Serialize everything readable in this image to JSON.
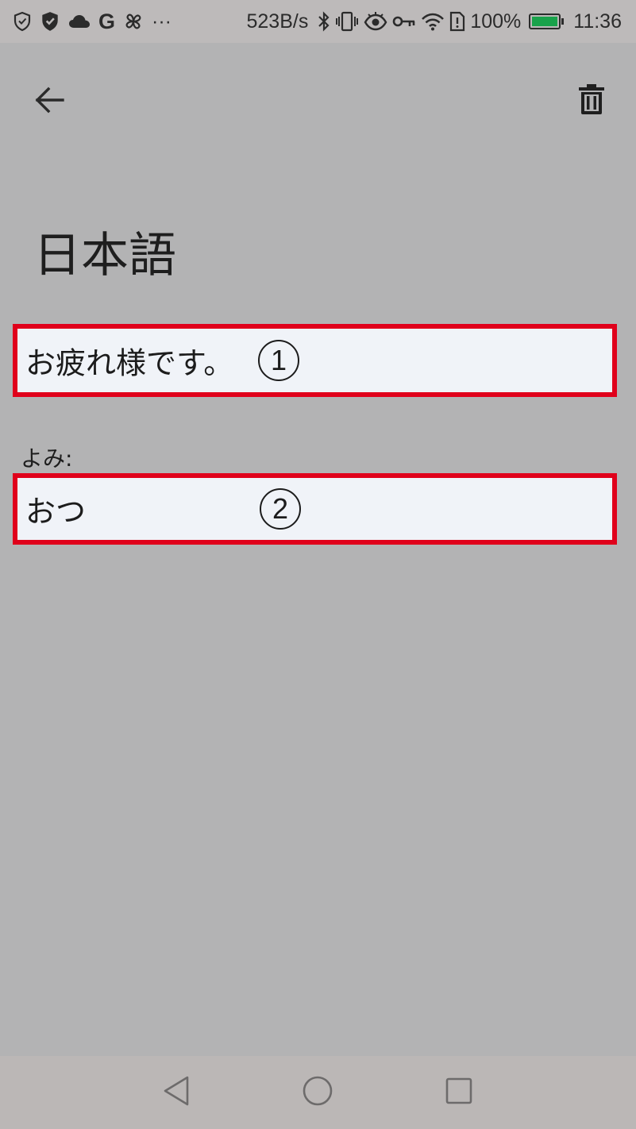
{
  "status_bar": {
    "left_icons": [
      "shield-outline-icon",
      "shield-check-icon",
      "cloud-icon",
      "google-g-icon",
      "pinwheel-icon",
      "more-dots-icon"
    ],
    "google_letter": "G",
    "more": "···",
    "net_speed": "523B/s",
    "right_icons": [
      "bluetooth-icon",
      "vibrate-icon",
      "eye-icon",
      "key-icon",
      "wifi-icon",
      "sim-alert-icon",
      "battery-icon"
    ],
    "battery": "100%",
    "battery_level": 1.0,
    "time": "11:36",
    "battery_color": "#19a24b"
  },
  "toolbar": {
    "back_icon": "arrow-left-icon",
    "delete_icon": "trash-icon"
  },
  "main": {
    "title": "日本語",
    "fields": [
      {
        "value": "お疲れ様です。",
        "marker": "1"
      },
      {
        "label": "よみ:",
        "value": "おつ",
        "marker": "2"
      }
    ]
  },
  "nav_bar": {
    "icons": [
      "nav-back-triangle-icon",
      "nav-home-circle-icon",
      "nav-recents-square-icon"
    ]
  },
  "colors": {
    "background": "#b3b3b4",
    "field_background": "#f0f3f8",
    "highlight_border": "#e0001b",
    "status_bar": "#bdbaba",
    "nav_bar": "#bbb7b6"
  }
}
